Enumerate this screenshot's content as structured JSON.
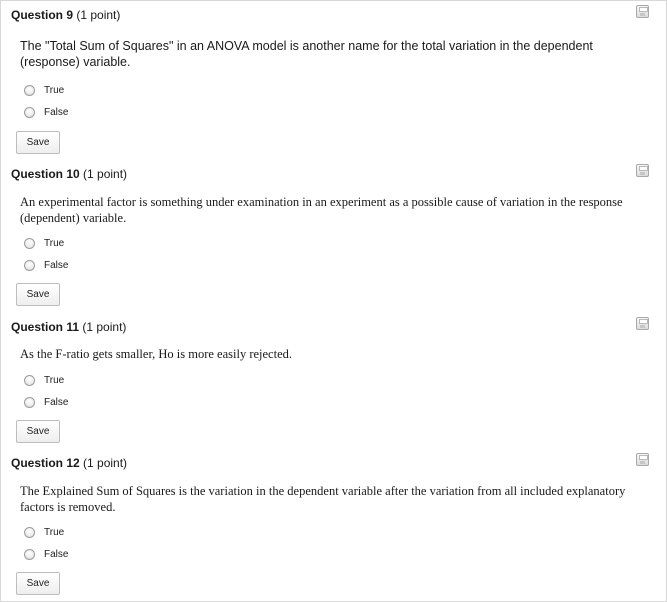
{
  "questions": [
    {
      "number_label": "Question 9",
      "points_label": "(1 point)",
      "text": "The \"Total Sum of Squares\" in an ANOVA model is another name for the total variation in the dependent (response) variable.",
      "options": [
        "True",
        "False"
      ],
      "save_label": "Save"
    },
    {
      "number_label": "Question 10",
      "points_label": "(1 point)",
      "text": "An experimental factor is something under examination in an experiment as a possible cause of variation in the response (dependent) variable.",
      "options": [
        "True",
        "False"
      ],
      "save_label": "Save"
    },
    {
      "number_label": "Question 11",
      "points_label": "(1 point)",
      "text": "As the F-ratio gets smaller, Ho is more easily rejected.",
      "options": [
        "True",
        "False"
      ],
      "save_label": "Save"
    },
    {
      "number_label": "Question 12",
      "points_label": "(1 point)",
      "text": "The Explained Sum of Squares is the variation in the dependent variable after the variation from all included explanatory factors is removed.",
      "options": [
        "True",
        "False"
      ],
      "save_label": "Save"
    }
  ]
}
